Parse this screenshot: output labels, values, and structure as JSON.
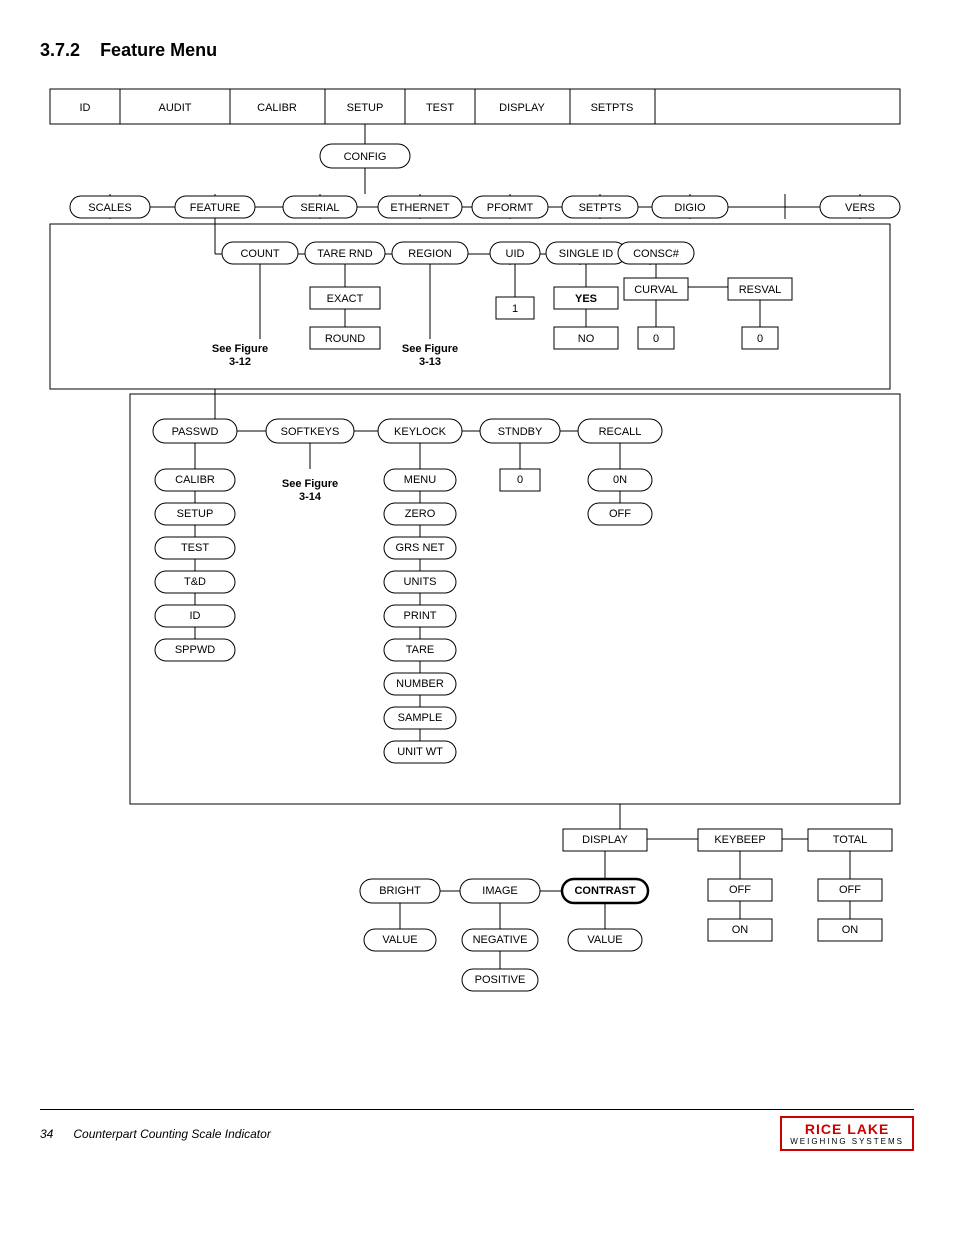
{
  "header": {
    "section": "3.7.2",
    "title": "Feature Menu"
  },
  "footer": {
    "page": "34",
    "description": "Counterpart Counting Scale Indicator",
    "logo_name": "RICE LAKE",
    "logo_sub": "WEIGHING SYSTEMS"
  },
  "diagram": {
    "nodes": {
      "id": "ID",
      "audit": "AUDIT",
      "calibr_top": "CALIBR",
      "setup_top": "SETUP",
      "test_top": "TEST",
      "display_top": "DISPLAY",
      "setpts_top": "SETPTS",
      "config": "CONFIG",
      "scales": "SCALES",
      "feature": "FEATURE",
      "serial": "SERIAL",
      "ethernet": "ETHERNET",
      "pformt": "PFORMT",
      "setpts": "SETPTS",
      "digio": "DIGIO",
      "vers": "VERS",
      "count": "COUNT",
      "tare_rnd": "TARE RND",
      "region": "REGION",
      "uid": "UID",
      "single_id": "SINGLE ID",
      "consc": "CONSC#",
      "exact": "EXACT",
      "round": "ROUND",
      "see_fig_312": "See Figure\n3-12",
      "see_fig_313": "See Figure\n3-13",
      "val1": "1",
      "yes": "YES",
      "no": "NO",
      "curval": "CURVAL",
      "resval": "RESVAL",
      "val0_curval": "0",
      "val0_resval": "0",
      "passwd": "PASSWD",
      "softkeys": "SOFTKEYS",
      "keylock": "KEYLOCK",
      "stndby": "STNDBY",
      "recall": "RECALL",
      "calibr": "CALIBR",
      "setup": "SETUP",
      "test": "TEST",
      "tnd": "T&D",
      "id2": "ID",
      "sppwd": "SPPWD",
      "see_fig_314": "See Figure\n3-14",
      "menu": "MENU",
      "zero": "ZERO",
      "grs_net": "GRS NET",
      "units": "UNITS",
      "print": "PRINT",
      "tare": "TARE",
      "number": "NUMBER",
      "sample": "SAMPLE",
      "unit_wt": "UNIT WT",
      "val0_stndby": "0",
      "on_recall": "0N",
      "off_recall": "OFF",
      "display2": "DISPLAY",
      "keybeep": "KEYBEEP",
      "total": "TOTAL",
      "bright": "BRIGHT",
      "image": "IMAGE",
      "contrast": "CONTRAST",
      "off_keybeep": "OFF",
      "on_keybeep": "ON",
      "off_total": "OFF",
      "on_total": "ON",
      "value_bright": "VALUE",
      "negative": "NEGATIVE",
      "positive": "POSITIVE",
      "value_contrast": "VALUE"
    }
  }
}
